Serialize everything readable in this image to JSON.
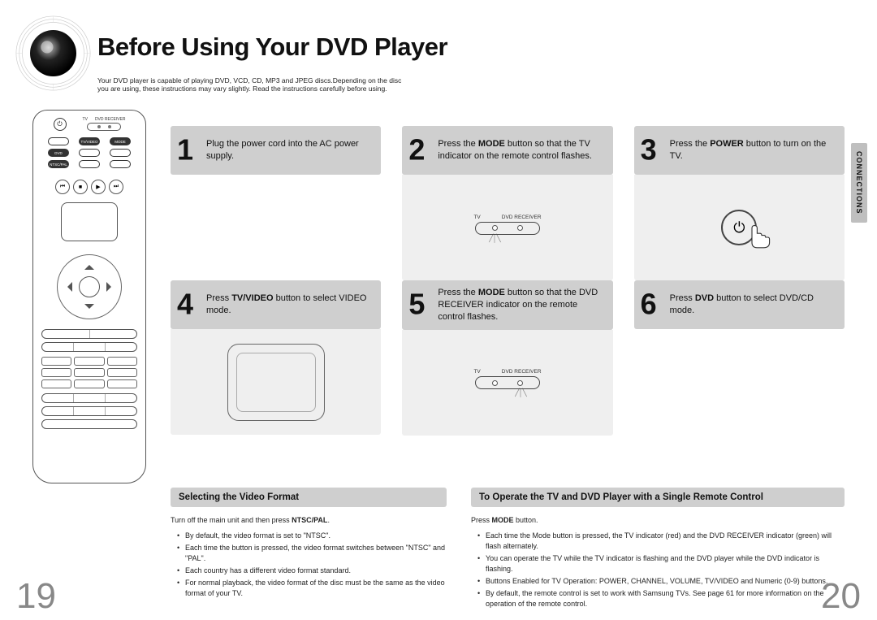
{
  "header": {
    "title": "Before Using Your DVD Player",
    "intro_line1": "Your DVD player is capable of playing DVD, VCD, CD, MP3 and JPEG discs.Depending on the disc",
    "intro_line2": "you are using, these instructions may vary slightly. Read the instructions carefully before using."
  },
  "side_tab": "CONNECTIONS",
  "remote": {
    "ind_tv": "TV",
    "ind_rcv": "DVD RECEIVER",
    "tv_video": "TV/VIDEO",
    "mode": "MODE",
    "dvd": "DVD",
    "ntscpal": "NTSC/PAL"
  },
  "steps": [
    {
      "num": "1",
      "text_pre": "Plug the power cord into the AC power supply."
    },
    {
      "num": "2",
      "text_pre": "Press the ",
      "bold": "MODE",
      "text_post": " button so that the TV indicator on the remote control flashes."
    },
    {
      "num": "3",
      "text_pre": "Press the ",
      "bold": "POWER",
      "text_post": " button to turn on the TV."
    },
    {
      "num": "4",
      "text_pre": "Press ",
      "bold": "TV/VIDEO",
      "text_post": " button to select VIDEO mode."
    },
    {
      "num": "5",
      "text_pre": "Press the ",
      "bold": "MODE",
      "text_post": " button so that the DVD RECEIVER indicator on the remote control flashes."
    },
    {
      "num": "6",
      "text_pre": "Press ",
      "bold": "DVD",
      "text_post": " button to select DVD/CD mode."
    }
  ],
  "section_a": {
    "title": "Selecting the Video Format",
    "lead_pre": "Turn off the main unit and then press ",
    "lead_bold": "NTSC/PAL",
    "lead_post": ".",
    "bullets": [
      "By default, the video format is set to \"NTSC\".",
      "Each time the button is pressed, the video format switches between \"NTSC\" and \"PAL\".",
      "Each country has a different video format standard.",
      "For normal playback, the video format of the disc must be the same as the video format of your TV."
    ]
  },
  "section_b": {
    "title": "To Operate the TV and DVD Player with a Single Remote Control",
    "lead_pre": "Press ",
    "lead_bold": "MODE",
    "lead_post": " button.",
    "bullets": [
      "Each time the Mode button is pressed, the TV indicator (red) and the DVD RECEIVER indicator (green) will flash alternately.",
      "You can operate the TV while the TV indicator is flashing and the DVD player while the DVD indicator is flashing.",
      "Buttons Enabled for TV Operation: POWER, CHANNEL, VOLUME, TV/VIDEO and Numeric (0-9) buttons.",
      "By default, the remote control is set to work with Samsung TVs.\nSee page 61 for more information on the operation of the remote control."
    ]
  },
  "diagram": {
    "tv": "TV",
    "rcv": "DVD RECEIVER"
  },
  "page_left": "19",
  "page_right": "20"
}
